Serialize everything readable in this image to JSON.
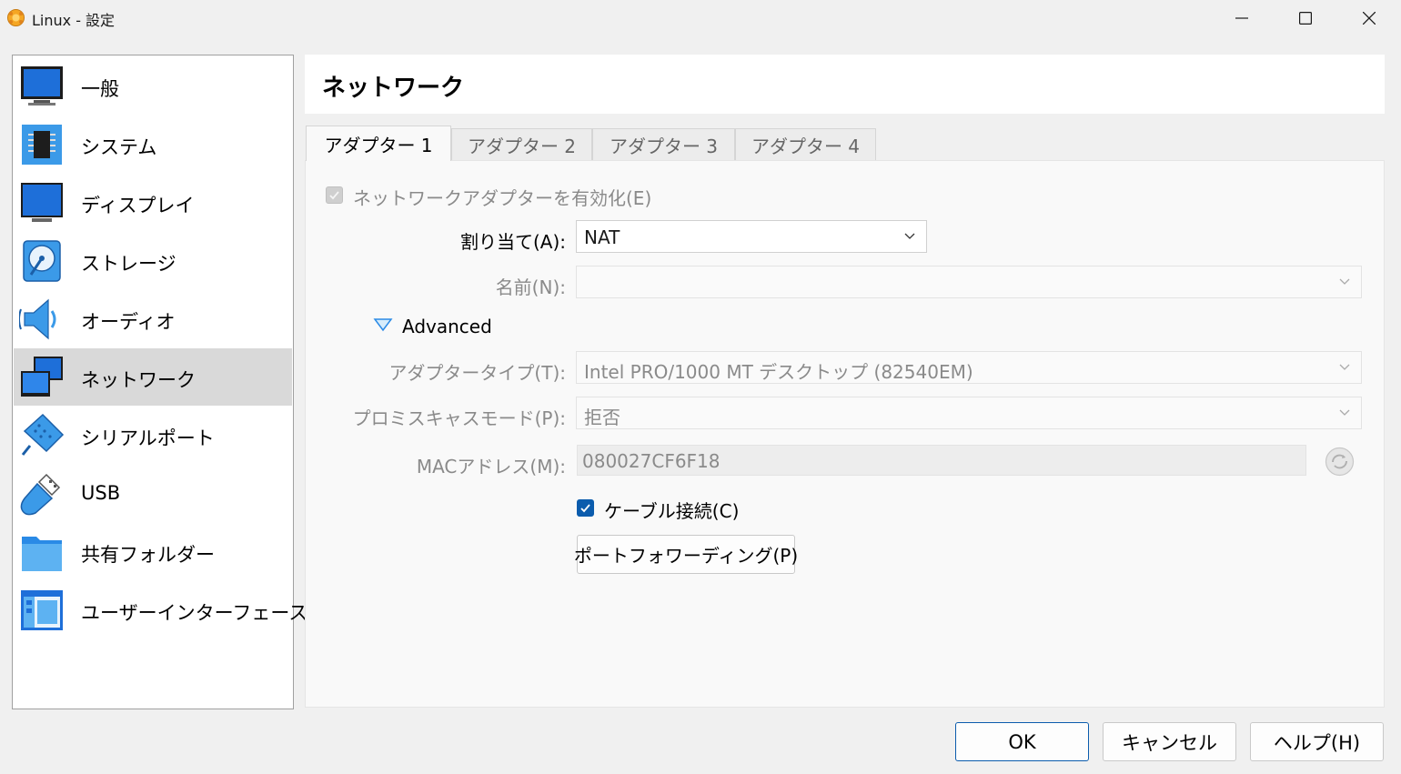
{
  "window": {
    "title": "Linux - 設定",
    "app_icon": "virtualbox-logo-icon",
    "controls": [
      "minimize-icon",
      "maximize-icon",
      "close-icon"
    ]
  },
  "sidebar": {
    "items": [
      {
        "label": "一般",
        "icon": "general-monitor-icon"
      },
      {
        "label": "システム",
        "icon": "system-chip-icon"
      },
      {
        "label": "ディスプレイ",
        "icon": "display-monitor-icon"
      },
      {
        "label": "ストレージ",
        "icon": "storage-disk-icon"
      },
      {
        "label": "オーディオ",
        "icon": "audio-speaker-icon"
      },
      {
        "label": "ネットワーク",
        "icon": "network-icon",
        "selected": true
      },
      {
        "label": "シリアルポート",
        "icon": "serial-port-icon"
      },
      {
        "label": "USB",
        "icon": "usb-icon"
      },
      {
        "label": "共有フォルダー",
        "icon": "shared-folder-icon"
      },
      {
        "label": "ユーザーインターフェース",
        "icon": "user-interface-icon"
      }
    ]
  },
  "panel": {
    "title": "ネットワーク",
    "tabs": [
      {
        "label": "アダプター 1",
        "active": true
      },
      {
        "label": "アダプター 2"
      },
      {
        "label": "アダプター 3"
      },
      {
        "label": "アダプター 4"
      }
    ],
    "enable_adapter": {
      "label": "ネットワークアダプターを有効化(E)",
      "checked": true,
      "enabled": false
    },
    "attached_to": {
      "label": "割り当て(A):",
      "value": "NAT"
    },
    "name": {
      "label": "名前(N):",
      "value": ""
    },
    "advanced": {
      "label": "Advanced",
      "expanded": true
    },
    "adapter_type": {
      "label": "アダプタータイプ(T):",
      "value": "Intel PRO/1000 MT デスクトップ (82540EM)"
    },
    "promiscuous_mode": {
      "label": "プロミスキャスモード(P):",
      "value": "拒否"
    },
    "mac_address": {
      "label": "MACアドレス(M):",
      "value": "080027CF6F18"
    },
    "cable_connected": {
      "label": "ケーブル接続(C)",
      "checked": true
    },
    "port_forwarding": {
      "label": "ポートフォワーディング(P)"
    }
  },
  "buttons": {
    "ok": "OK",
    "cancel": "キャンセル",
    "help": "ヘルプ(H)"
  },
  "colors": {
    "accent": "#0b5cad",
    "icon_blue": "#1e88e5",
    "selection": "#d9d9d9"
  }
}
